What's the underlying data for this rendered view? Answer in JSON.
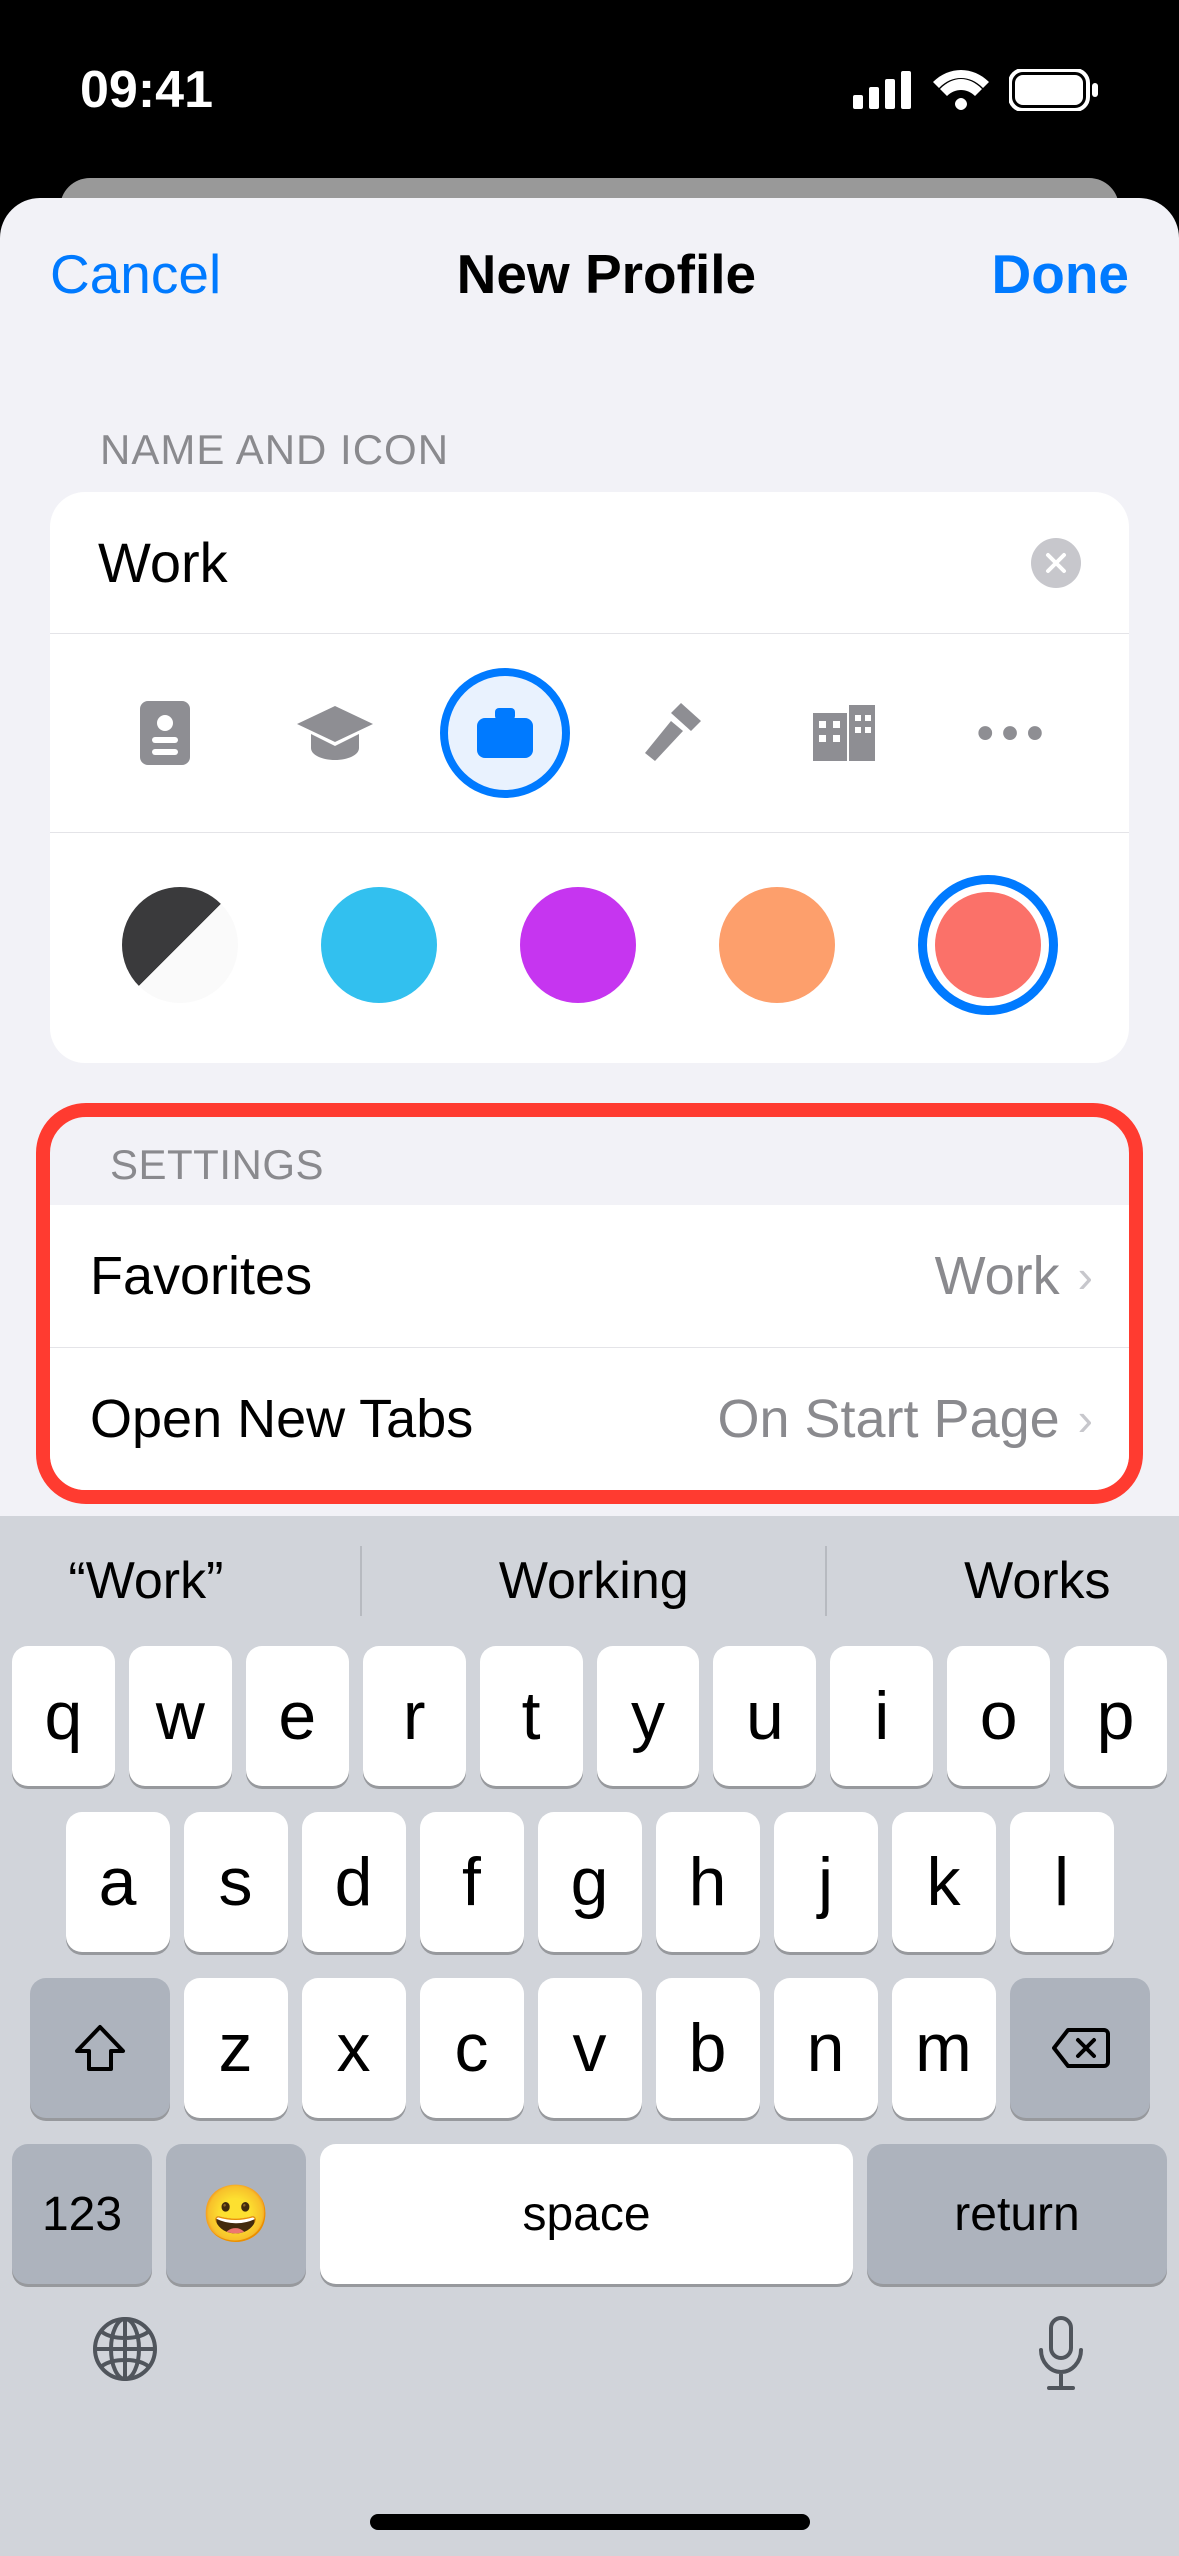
{
  "status": {
    "time": "09:41"
  },
  "nav": {
    "cancel": "Cancel",
    "title": "New Profile",
    "done": "Done"
  },
  "sections": {
    "name_and_icon_header": "NAME AND ICON",
    "settings_header": "SETTINGS"
  },
  "profile": {
    "name_value": "Work",
    "icons": [
      {
        "name": "badge-icon",
        "selected": false
      },
      {
        "name": "graduation-cap-icon",
        "selected": false
      },
      {
        "name": "briefcase-icon",
        "selected": true
      },
      {
        "name": "hammer-icon",
        "selected": false
      },
      {
        "name": "building-icon",
        "selected": false
      },
      {
        "name": "more-icon",
        "selected": false
      }
    ],
    "colors": [
      {
        "name": "black-white",
        "hex": "bw",
        "selected": false
      },
      {
        "name": "cyan",
        "hex": "#32c0ef",
        "selected": false
      },
      {
        "name": "purple",
        "hex": "#c635f0",
        "selected": false
      },
      {
        "name": "orange",
        "hex": "#fd9f6c",
        "selected": false
      },
      {
        "name": "coral",
        "hex": "#fb7169",
        "selected": true
      }
    ]
  },
  "settings": {
    "favorites": {
      "label": "Favorites",
      "value": "Work"
    },
    "open_new_tabs": {
      "label": "Open New Tabs",
      "value": "On Start Page"
    }
  },
  "keyboard": {
    "suggestions": [
      "“Work”",
      "Working",
      "Works"
    ],
    "row1": [
      "q",
      "w",
      "e",
      "r",
      "t",
      "y",
      "u",
      "i",
      "o",
      "p"
    ],
    "row2": [
      "a",
      "s",
      "d",
      "f",
      "g",
      "h",
      "j",
      "k",
      "l"
    ],
    "row3": [
      "z",
      "x",
      "c",
      "v",
      "b",
      "n",
      "m"
    ],
    "numeric_label": "123",
    "space_label": "space",
    "return_label": "return"
  }
}
